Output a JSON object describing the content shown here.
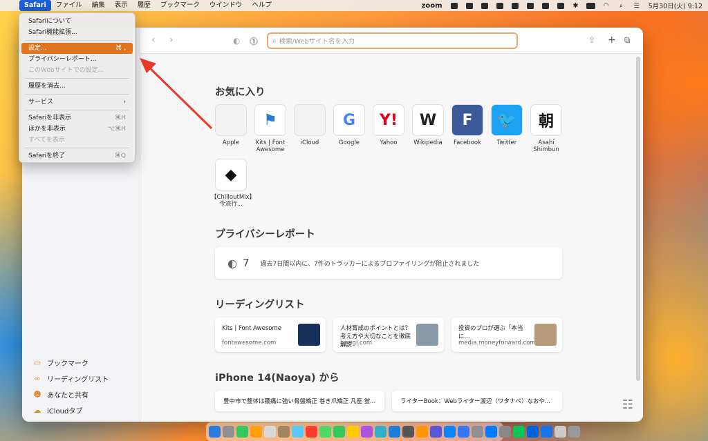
{
  "menubar": {
    "items": [
      "Safari",
      "ファイル",
      "編集",
      "表示",
      "履歴",
      "ブックマーク",
      "ウインドウ",
      "ヘルプ"
    ],
    "zoom_label": "zoom",
    "clock": "5月30日(火) 9:12"
  },
  "dropdown": {
    "items": [
      {
        "label": "Safariについて",
        "shortcut": ""
      },
      {
        "label": "Safari機能拡張...",
        "shortcut": ""
      },
      {
        "label": "設定...",
        "shortcut": "⌘ ,"
      },
      {
        "label": "プライバシーレポート...",
        "shortcut": ""
      },
      {
        "label": "このWebサイトでの設定...",
        "shortcut": ""
      },
      {
        "label": "履歴を消去...",
        "shortcut": ""
      },
      {
        "label": "サービス",
        "shortcut": "›"
      },
      {
        "label": "Safariを非表示",
        "shortcut": "⌘H"
      },
      {
        "label": "ほかを非表示",
        "shortcut": "⌥⌘H"
      },
      {
        "label": "すべてを表示",
        "shortcut": ""
      },
      {
        "label": "Safariを終了",
        "shortcut": "⌘Q"
      }
    ]
  },
  "toolbar": {
    "address_placeholder": "検索/Webサイト名を入力"
  },
  "sidebar": {
    "items": [
      "ブックマーク",
      "リーディングリスト",
      "あなたと共有",
      "iCloudタブ"
    ]
  },
  "favorites": {
    "title": "お気に入り",
    "items": [
      {
        "label": "Apple",
        "glyph": "",
        "color": "#555555",
        "bg": "#f2f2f2"
      },
      {
        "label": "Kits | Font Awesome",
        "glyph": "⚑",
        "color": "#2e7bd6",
        "bg": "#ffffff"
      },
      {
        "label": "iCloud",
        "glyph": "",
        "color": "#555555",
        "bg": "#f2f2f2"
      },
      {
        "label": "Google",
        "glyph": "G",
        "color": "#4285f4",
        "bg": "#ffffff"
      },
      {
        "label": "Yahoo",
        "glyph": "Y!",
        "color": "#e0001b",
        "bg": "#ffffff"
      },
      {
        "label": "Wikipedia",
        "glyph": "W",
        "color": "#222222",
        "bg": "#ffffff"
      },
      {
        "label": "Facebook",
        "glyph": "F",
        "color": "#ffffff",
        "bg": "#3b5998"
      },
      {
        "label": "Twitter",
        "glyph": "🐦",
        "color": "#ffffff",
        "bg": "#1da1f2"
      },
      {
        "label": "Asahi Shimbun",
        "glyph": "朝",
        "color": "#111111",
        "bg": "#ffffff"
      },
      {
        "label": "【ChilloutMix】今流行...",
        "glyph": "◆",
        "color": "#111111",
        "bg": "#ffffff"
      }
    ]
  },
  "privacy": {
    "title": "プライバシーレポート",
    "count": "7",
    "message": "過去7日間以内に、7件のトラッカーによるプロファイリングが阻止されました"
  },
  "reading_list": {
    "title": "リーディングリスト",
    "items": [
      {
        "title": "Kits | Font Awesome",
        "url": "fontawesome.com",
        "thumb": "#16315a"
      },
      {
        "title": "人材育成のポイントとは？考え方や大切なことを徹底解説",
        "url": "bowgl.com",
        "thumb": "#8a9aa8"
      },
      {
        "title": "投資のプロが選ぶ「本当に...",
        "url": "media.moneyforward.com",
        "thumb": "#b79a7a"
      }
    ]
  },
  "iphone_tabs": {
    "title": "iPhone 14(Naoya) から",
    "items": [
      "豊中市で整体は腰痛に強い骨盤矯正 巻き爪矯正 凡座 蛍...",
      "ライターBook：Webライター渡辺（ワタナベ）なおや..."
    ]
  },
  "colors": {
    "accent": "#e0741f",
    "arrow": "#e8392b"
  }
}
